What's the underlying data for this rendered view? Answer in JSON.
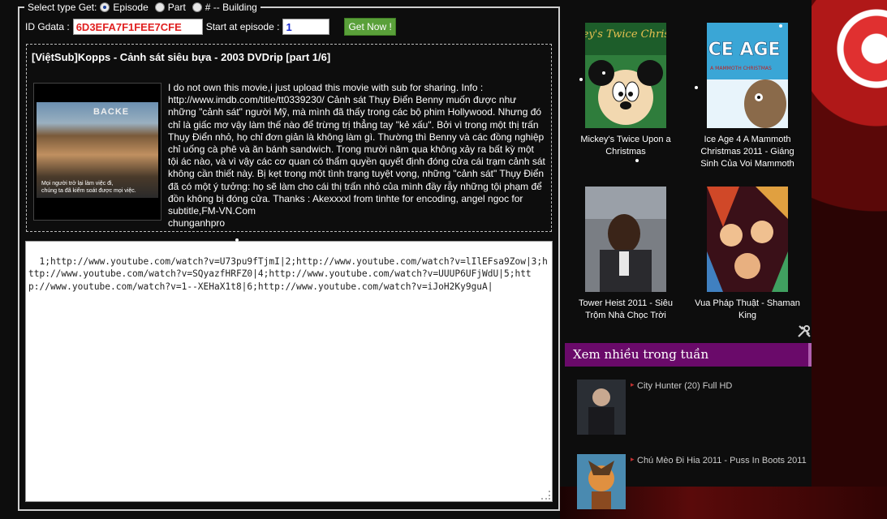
{
  "form": {
    "legend_prefix": "Select type Get:",
    "radio_episode": "Episode",
    "radio_part": "Part",
    "radio_hash": "# -- Building",
    "id_label": "ID Gdata :",
    "id_value": "6D3EFA7F1FEE7CFE",
    "start_label": "Start at episode :",
    "start_value": "1",
    "get_button": "Get Now !"
  },
  "video": {
    "title": "[ViệtSub]Kopps - Cảnh sát siêu bựa - 2003 DVDrip [part 1/6]",
    "thumb_sign": "BACKE",
    "thumb_caption_1": "Mọi người trở lại làm việc đi,",
    "thumb_caption_2": "chúng ta đã kiểm soát được mọi việc.",
    "description": "I do not own this movie,i just upload this movie with sub for sharing. Info : http://www.imdb.com/title/tt0339230/ Cảnh sát Thụy Điển Benny muốn được như những \"cảnh sát\" người Mỹ, mà mình đã thấy trong các bộ phim Hollywood. Nhưng đó chỉ là giấc mơ vậy làm thế nào để trừng trị thẳng tay \"kẻ xấu\". Bởi vì trong một thị trấn Thụy Điển nhỏ, họ chỉ đơn giản là không làm gì. Thường thì Benny và các đồng nghiệp chỉ uống cà phê và ăn bánh sandwich. Trong mười năm qua không xảy ra bất kỳ một tội ác nào, và vì vậy các cơ quan có thẩm quyền quyết định đóng cửa cái trạm cảnh sát không cần thiết này. Bị kẹt trong một tình trạng tuyệt vọng, những \"cảnh sát\" Thụy Điển đã có một ý tưởng: họ sẽ làm cho cái thị trấn nhỏ của mình đầy rẫy những tội phạm để đồn không bị đóng cửa. Thanks : Akexxxxl from tinhte for encoding, angel ngoc for subtitle,FM-VN.Com",
    "uploader": "chunganhpro"
  },
  "links_text": "1;http://www.youtube.com/watch?v=U73pu9fTjmI|2;http://www.youtube.com/watch?v=lIlEFsa9Zow|3;http://www.youtube.com/watch?v=SQyazfHRFZ0|4;http://www.youtube.com/watch?v=UUUP6UFjWdU|5;http://www.youtube.com/watch?v=1--XEHaX1t8|6;http://www.youtube.com/watch?v=iJoH2Ky9guA|",
  "posters": [
    {
      "title": "Mickey's Twice Upon a Christmas",
      "art_text": "Mickey's Twice Christmas",
      "icon": "mickey-poster"
    },
    {
      "title": "Ice Age 4 A Mammoth Christmas 2011 - Giáng Sinh Của Voi Mammoth",
      "art_text": "ICE AGE",
      "art_sub": "A MAMMOTH CHRISTMAS",
      "icon": "ice-age-poster"
    },
    {
      "title": "Tower Heist 2011 - Siêu Trộm Nhà Chọc Trời",
      "icon": "tower-heist-poster"
    },
    {
      "title": "Vua Pháp Thuật - Shaman King",
      "icon": "shaman-king-poster"
    }
  ],
  "weekly": {
    "header": "Xem nhiều trong tuần",
    "items": [
      {
        "title": "City Hunter (20) Full HD"
      },
      {
        "title": "Chú Mèo Đi Hia 2011 - Puss In Boots 2011"
      }
    ]
  },
  "colors": {
    "id_text": "#e02020",
    "episode_text": "#1a2ad0",
    "button_green": "#5aa03a",
    "header_purple": "#6a0a6a"
  }
}
